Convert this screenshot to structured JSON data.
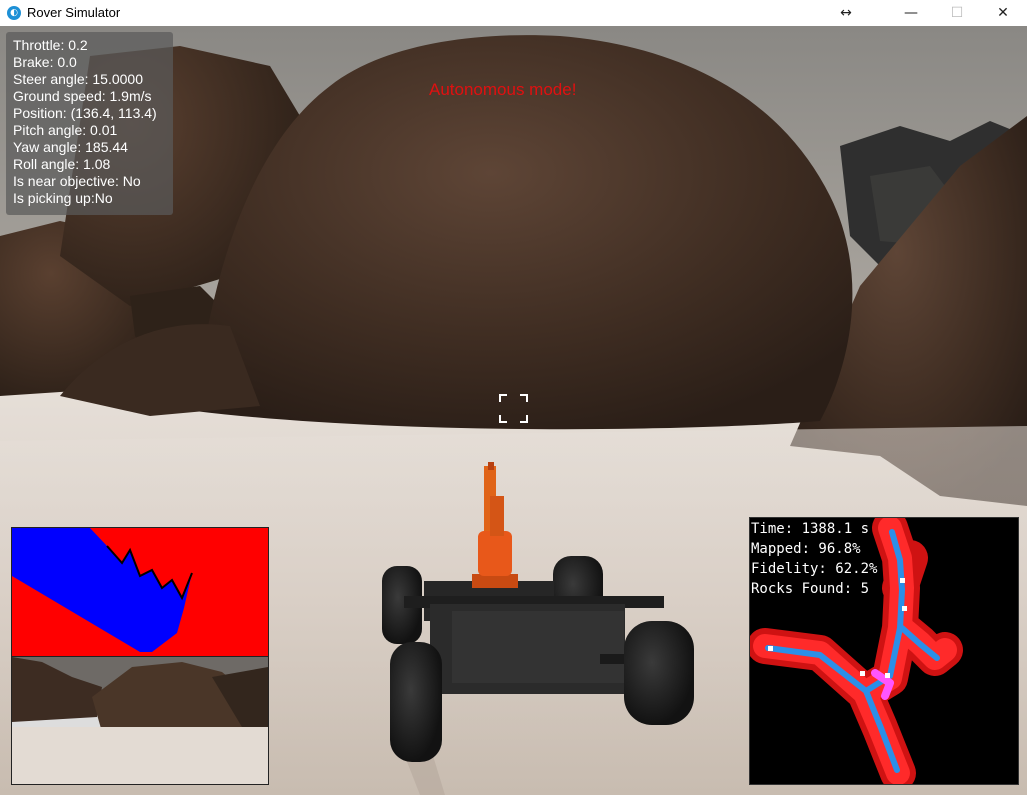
{
  "window": {
    "title": "Rover Simulator",
    "app_icon": "unity-logo-icon",
    "resize_icon": "↔",
    "minimize_icon": "—",
    "maximize_icon": "☐",
    "close_icon": "✕"
  },
  "telemetry": {
    "throttle": "Throttle: 0.2",
    "brake": "Brake: 0.0",
    "steer_angle": "Steer angle: 15.0000",
    "ground_speed": "Ground speed: 1.9m/s",
    "position": "Position: (136.4, 113.4)",
    "pitch_angle": "Pitch angle: 0.01",
    "yaw_angle": "Yaw angle: 185.44",
    "roll_angle": "Roll angle: 1.08",
    "near_objective": "Is near objective: No",
    "picking_up": "Is picking up:No"
  },
  "mode_banner": "Autonomous mode!",
  "map_overlay": {
    "time": "Time: 1388.1 s",
    "mapped": "Mapped: 96.8%",
    "fidelity": "Fidelity: 62.2%",
    "rocks_found": "Rocks Found: 5"
  },
  "colors": {
    "banner": "#e01010",
    "vision_obstacle": "#ff0000",
    "vision_navigable": "#0000ff",
    "map_background": "#000000",
    "map_obstacle": "#ff1a1a",
    "map_navigable": "#3399ff",
    "rover_orange": "#e8581a"
  }
}
